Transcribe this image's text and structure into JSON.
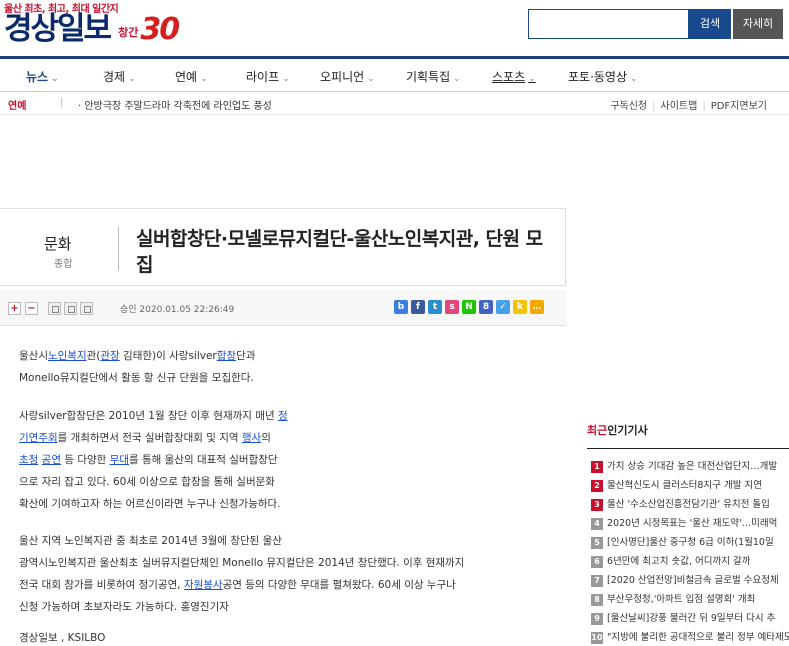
{
  "header": {
    "slogan": "울산 최초, 최고, 최대 일간지",
    "logo_text": "경상일보",
    "anniversary_label": "창간",
    "anniversary_number": "30",
    "search_button": "검색",
    "detail_button": "자세히"
  },
  "nav": {
    "items": [
      {
        "label": "뉴스",
        "chevron": "⌄"
      },
      {
        "label": "경제",
        "chevron": "⌄"
      },
      {
        "label": "연예",
        "chevron": "⌄"
      },
      {
        "label": "라이프",
        "chevron": "⌄"
      },
      {
        "label": "오피니언",
        "chevron": "⌄"
      },
      {
        "label": "기획특집",
        "chevron": "⌄"
      },
      {
        "label": "스포츠",
        "chevron": "⌄"
      },
      {
        "label": "포토·동영상",
        "chevron": "⌄"
      }
    ]
  },
  "subbar": {
    "flash_label": "연예",
    "flash_sep": "|",
    "flash_text": "· 안방극장 주말드라마 각축전에 라인업도 풍성",
    "util": [
      "구독신청",
      "사이트맵",
      "PDF지면보기"
    ]
  },
  "article": {
    "section": "문화",
    "subsection": "종합",
    "title": "실버합창단·모넬로뮤지컬단-울산노인복지관, 단원 모집",
    "pub_date": "승인 2020.01.05  22:26:49",
    "toolbar": {
      "plus": "+",
      "minus": "−"
    },
    "p1": {
      "a": "울산시",
      "b": "노인복지",
      "c": "관(",
      "d": "관장",
      "e": " 김태한)이 사랑silver",
      "f": "합창",
      "g": "단과",
      "h": "Monello뮤지컬단에서 활동 할 신규 단원을 모집한다."
    },
    "p2": {
      "a": "사랑silver합창단은 2010년 1월 창단 이후 현재까지 매년 ",
      "b": "정",
      "c": "기연주회",
      "d": "를 개최하면서 전국 실버합창대회 및 지역 ",
      "e": "행사",
      "f": "의",
      "g": "초청",
      "h": " ",
      "i": "공연",
      "j": " 등 다양한 ",
      "k": "무대",
      "l": "를 통해 울산의 대표적 실버합창단",
      "m": "으로 자리 잡고 있다. 60세 이상으로 합창을 통해 실버문화",
      "n": "확산에 기여하고자 하는 어르신이라면 누구나 신청가능하다."
    },
    "p3": {
      "a": "울산 지역 노인복지관 중 최초로 2014년 3월에 창단된 울산",
      "b": "광역시노인복지관 울산최초 실버뮤지컬단체인 Monello 뮤지컬단은 2014년 창단했다. 이후 현재까지",
      "c": "전국 대회 참가를 비롯하여 정기공연, ",
      "d": "자원봉사",
      "e": "공연 등의 다양한 무대를 펼쳐왔다. 60세 이상 누구나",
      "f": "신청 가능하며 초보자라도 가능하다. 홍영진기자"
    },
    "byline": "경상일보 , KSILBO"
  },
  "popular": {
    "title_red": "최근",
    "title_rest": "인기기사",
    "items": [
      {
        "num": "1",
        "text": "가치 상승 기대감 높은 대전산업단지…개발"
      },
      {
        "num": "2",
        "text": "울산혁신도시 클러스터8지구 개발 지연"
      },
      {
        "num": "3",
        "text": "울산 '수소산업진흥전담기관' 유치전 돌입"
      },
      {
        "num": "4",
        "text": "2020년 시정목표는 '울산 재도약'…미래먹"
      },
      {
        "num": "5",
        "text": "[인사명단]울산 중구청 6급 이하(1월10일"
      },
      {
        "num": "6",
        "text": "6년만에 최고치 솟값, 어디까지 갈까"
      },
      {
        "num": "7",
        "text": "[2020 산업전망]비철금속 글로벌 수요정체"
      },
      {
        "num": "8",
        "text": "부산우정청,'아파트 입점 설명회' 개최"
      },
      {
        "num": "9",
        "text": "[울산날씨]강풍 물러간 뒤 9일부터 다시 추"
      },
      {
        "num": "10",
        "text": "\"지방에 불리한 공대적으로 불리 정부 예타제도 개"
      }
    ]
  },
  "colors": {
    "brand_navy": "#0b2a6b",
    "brand_red": "#c8102e",
    "link_blue": "#1a4fd6"
  }
}
